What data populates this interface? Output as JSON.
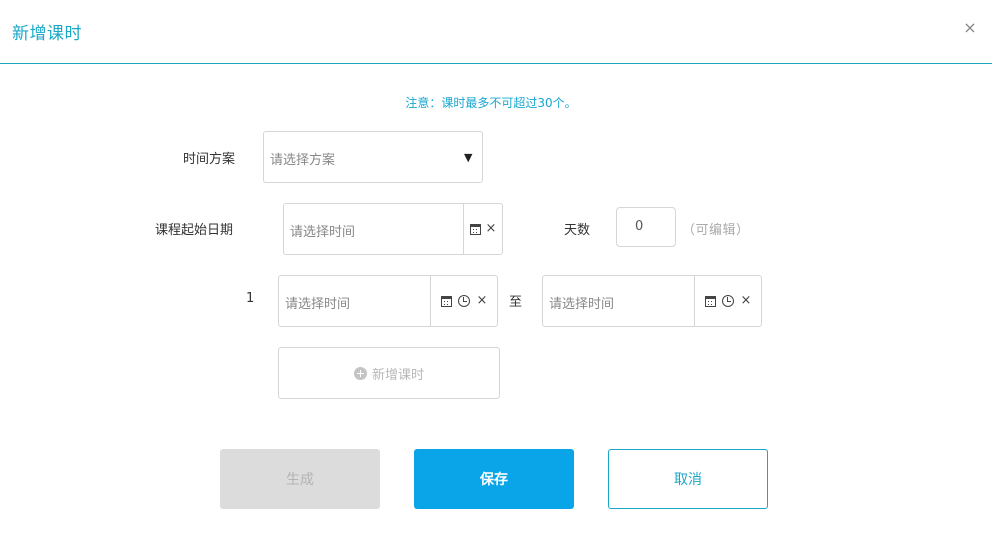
{
  "dialog": {
    "title": "新增课时",
    "close_glyph": "×"
  },
  "notice": "注意：课时最多不可超过30个。",
  "plan": {
    "label": "时间方案",
    "placeholder": "请选择方案",
    "arrow": "▼"
  },
  "start_date": {
    "label": "课程起始日期",
    "placeholder": "请选择时间"
  },
  "days": {
    "label": "天数",
    "value": "0",
    "hint": "（可编辑）"
  },
  "session": {
    "index": "1",
    "from_placeholder": "请选择时间",
    "separator": "至",
    "to_placeholder": "请选择时间"
  },
  "add_session_label": "新增课时",
  "buttons": {
    "generate": "生成",
    "save": "保存",
    "cancel": "取消"
  },
  "icons": [
    "close-icon",
    "chevron-down-icon",
    "calendar-icon",
    "clock-icon",
    "clear-icon",
    "plus-circle-icon"
  ],
  "colors": {
    "accent": "#19a8c8",
    "primary": "#0aa5e8",
    "disabled": "#dcdcdc"
  }
}
